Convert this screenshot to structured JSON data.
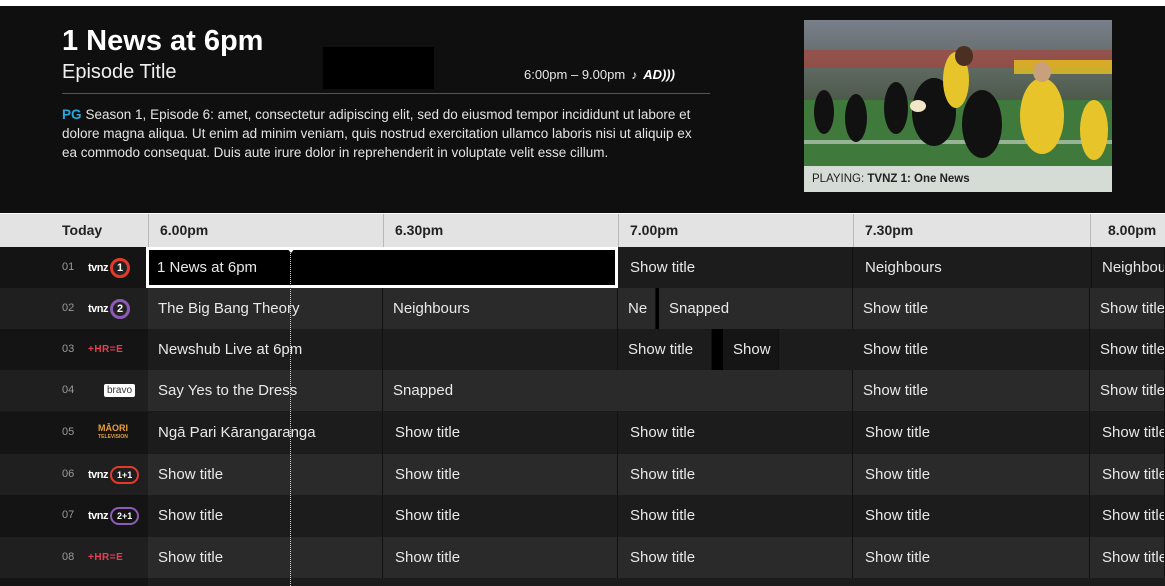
{
  "header": {
    "title": "1 News at 6pm",
    "subtitle": "Episode Title",
    "time_range": "6:00pm – 9.00pm",
    "cc_icon": "closed-captions-icon",
    "ad_icon": "audio-description-icon",
    "ad_label": "AD",
    "rating": "PG",
    "description": "Season 1, Episode 6:   amet, consectetur adipiscing elit, sed do eiusmod tempor incididunt ut labore et dolore magna aliqua. Ut enim ad minim veniam, quis nostrud exercitation ullamco laboris nisi ut aliquip ex ea commodo consequat. Duis aute irure dolor in reprehenderit in voluptate velit esse cillum.",
    "playing_label": "PLAYING: ",
    "playing_channel": "TVNZ 1: One News"
  },
  "timebar": {
    "today": "Today",
    "slots": [
      "6.00pm",
      "6.30pm",
      "7.00pm",
      "7.30pm",
      "8.00pm"
    ]
  },
  "channels": [
    {
      "num": "01",
      "logo": "tvnz-1-logo",
      "logo_word": "tvnz",
      "logo_mark": "1",
      "programs": [
        "1 News at 6pm",
        "Show title",
        "Neighbours",
        "Neighbours"
      ]
    },
    {
      "num": "02",
      "logo": "tvnz-2-logo",
      "logo_word": "tvnz",
      "logo_mark": "2",
      "programs": [
        "The Big Bang Theory",
        "Neighbours",
        "Ne",
        "Snapped",
        "Show title",
        "Show title"
      ]
    },
    {
      "num": "03",
      "logo": "three-logo",
      "logo_word": "+HR=E",
      "programs": [
        "Newshub Live at 6pm",
        "",
        "Show title",
        "Show",
        "Show title",
        "Show title"
      ]
    },
    {
      "num": "04",
      "logo": "bravo-logo",
      "logo_word": "bravo",
      "programs": [
        "Say Yes to the Dress",
        "Snapped",
        "Show title",
        "Show title"
      ]
    },
    {
      "num": "05",
      "logo": "maori-tv-logo",
      "logo_word": "MĀORI",
      "logo_sub": "TELEVISION",
      "programs": [
        "Ngā Pari Kārangaranga",
        "Show title",
        "Show title",
        "Show title",
        "Show title"
      ]
    },
    {
      "num": "06",
      "logo": "tvnz-1-plus1-logo",
      "logo_word": "tvnz",
      "logo_mark": "1+1",
      "programs": [
        "Show title",
        "Show title",
        "Show title",
        "Show title",
        "Show title"
      ]
    },
    {
      "num": "07",
      "logo": "tvnz-2-plus1-logo",
      "logo_word": "tvnz",
      "logo_mark": "2+1",
      "programs": [
        "Show title",
        "Show title",
        "Show title",
        "Show title",
        "Show title"
      ]
    },
    {
      "num": "08",
      "logo": "three-plus1-logo",
      "logo_word": "+HR=E",
      "programs": [
        "Show title",
        "Show title",
        "Show title",
        "Show title",
        "Show title"
      ]
    }
  ],
  "colors": {
    "header_bg": "#0f0f10",
    "rating_accent": "#2aa7df",
    "tvnz1_red": "#e53a2a",
    "tvnz2_purple": "#8b5bb5",
    "three_pink": "#e54054",
    "maori_orange": "#e6a03a"
  }
}
